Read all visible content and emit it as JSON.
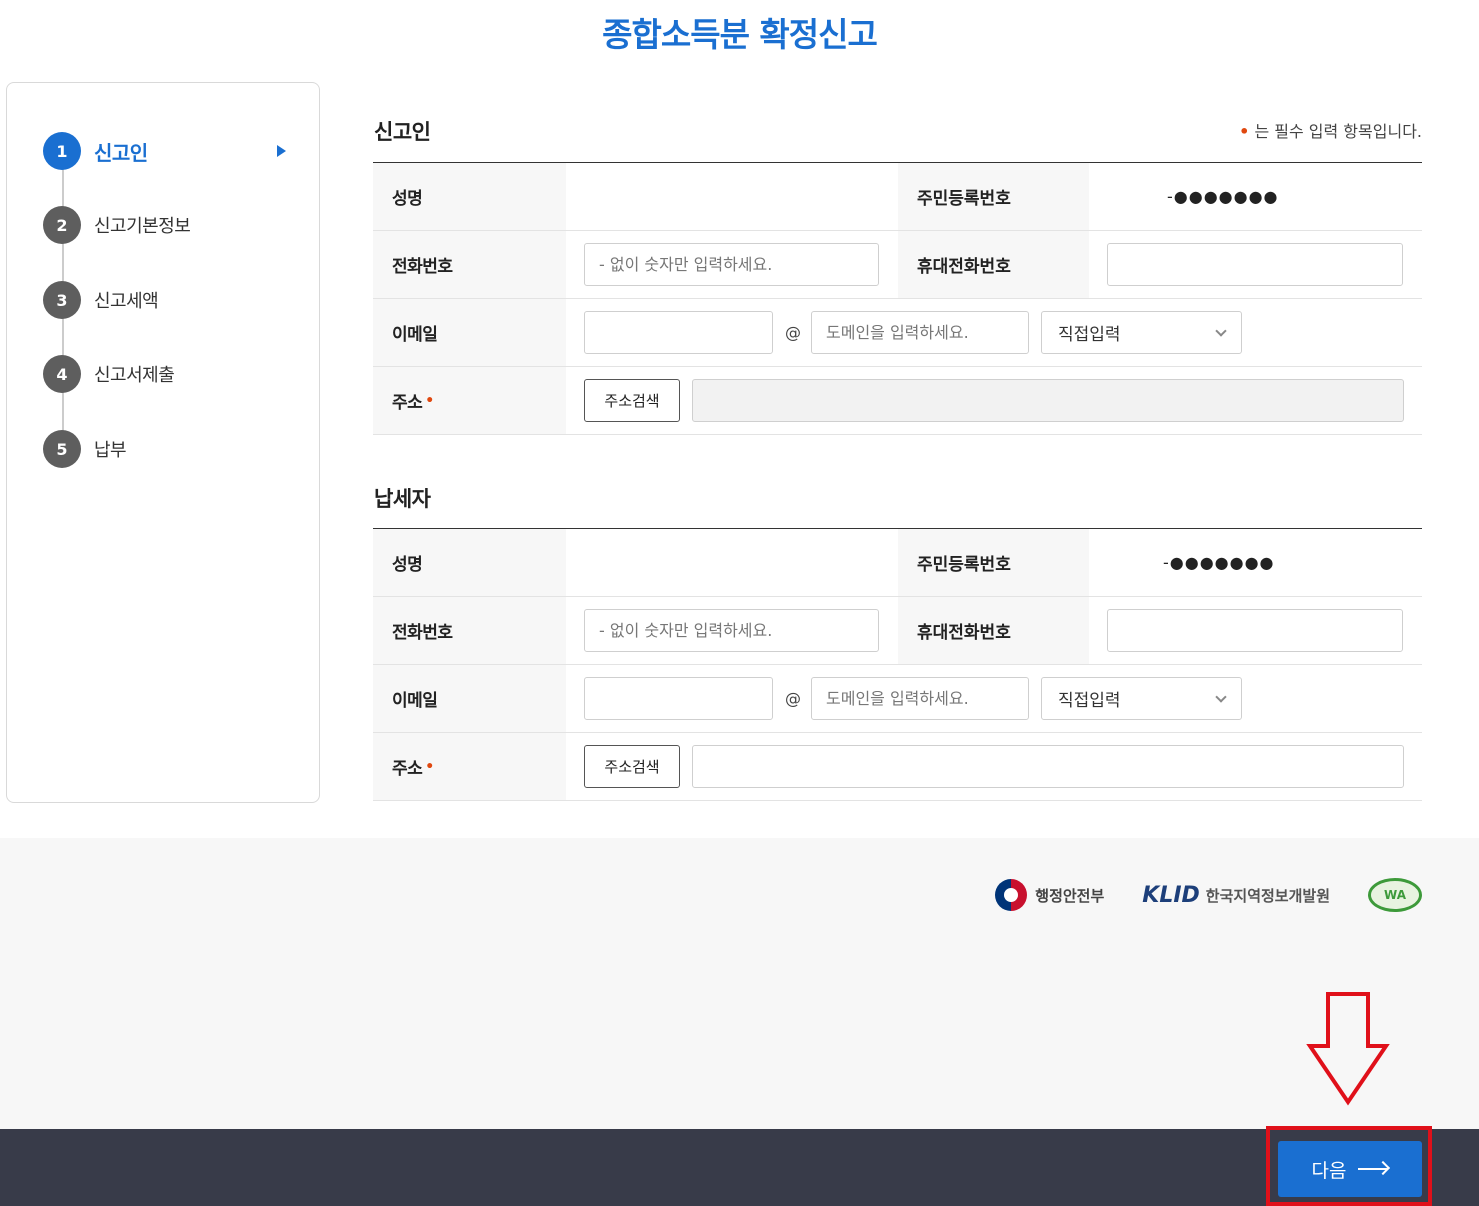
{
  "page": {
    "title": "종합소득분 확정신고"
  },
  "steps": [
    {
      "num": "1",
      "label": "신고인",
      "active": true
    },
    {
      "num": "2",
      "label": "신고기본정보"
    },
    {
      "num": "3",
      "label": "신고세액"
    },
    {
      "num": "4",
      "label": "신고서제출"
    },
    {
      "num": "5",
      "label": "납부"
    }
  ],
  "required_note": "는 필수 입력 항목입니다.",
  "required_dot": "•",
  "reporter": {
    "title": "신고인",
    "labels": {
      "name": "성명",
      "rrn": "주민등록번호",
      "phone": "전화번호",
      "mobile": "휴대전화번호",
      "email": "이메일",
      "address": "주소"
    },
    "rrn_masked": "-●●●●●●●",
    "phone_placeholder": "- 없이 숫자만 입력하세요.",
    "domain_placeholder": "도메인을 입력하세요.",
    "at": "@",
    "email_select": "직접입력",
    "address_button": "주소검색",
    "required_mark": "•"
  },
  "taxpayer": {
    "title": "납세자",
    "labels": {
      "name": "성명",
      "rrn": "주민등록번호",
      "phone": "전화번호",
      "mobile": "휴대전화번호",
      "email": "이메일",
      "address": "주소"
    },
    "rrn_masked": "-●●●●●●●",
    "phone_placeholder": "- 없이 숫자만 입력하세요.",
    "domain_placeholder": "도메인을 입력하세요.",
    "at": "@",
    "email_select": "직접입력",
    "address_button": "주소검색",
    "required_mark": "•"
  },
  "footer": {
    "logos": {
      "mois": "행정안전부",
      "klid_mark": "KLID",
      "klid_name": "한국지역정보개발원",
      "wa": "WA"
    }
  },
  "bottom": {
    "next_label": "다음"
  },
  "colors": {
    "accent": "#1a6fd1",
    "required": "#e0480f",
    "annotation": "#e0101a",
    "bottom_bar": "#383b49"
  }
}
